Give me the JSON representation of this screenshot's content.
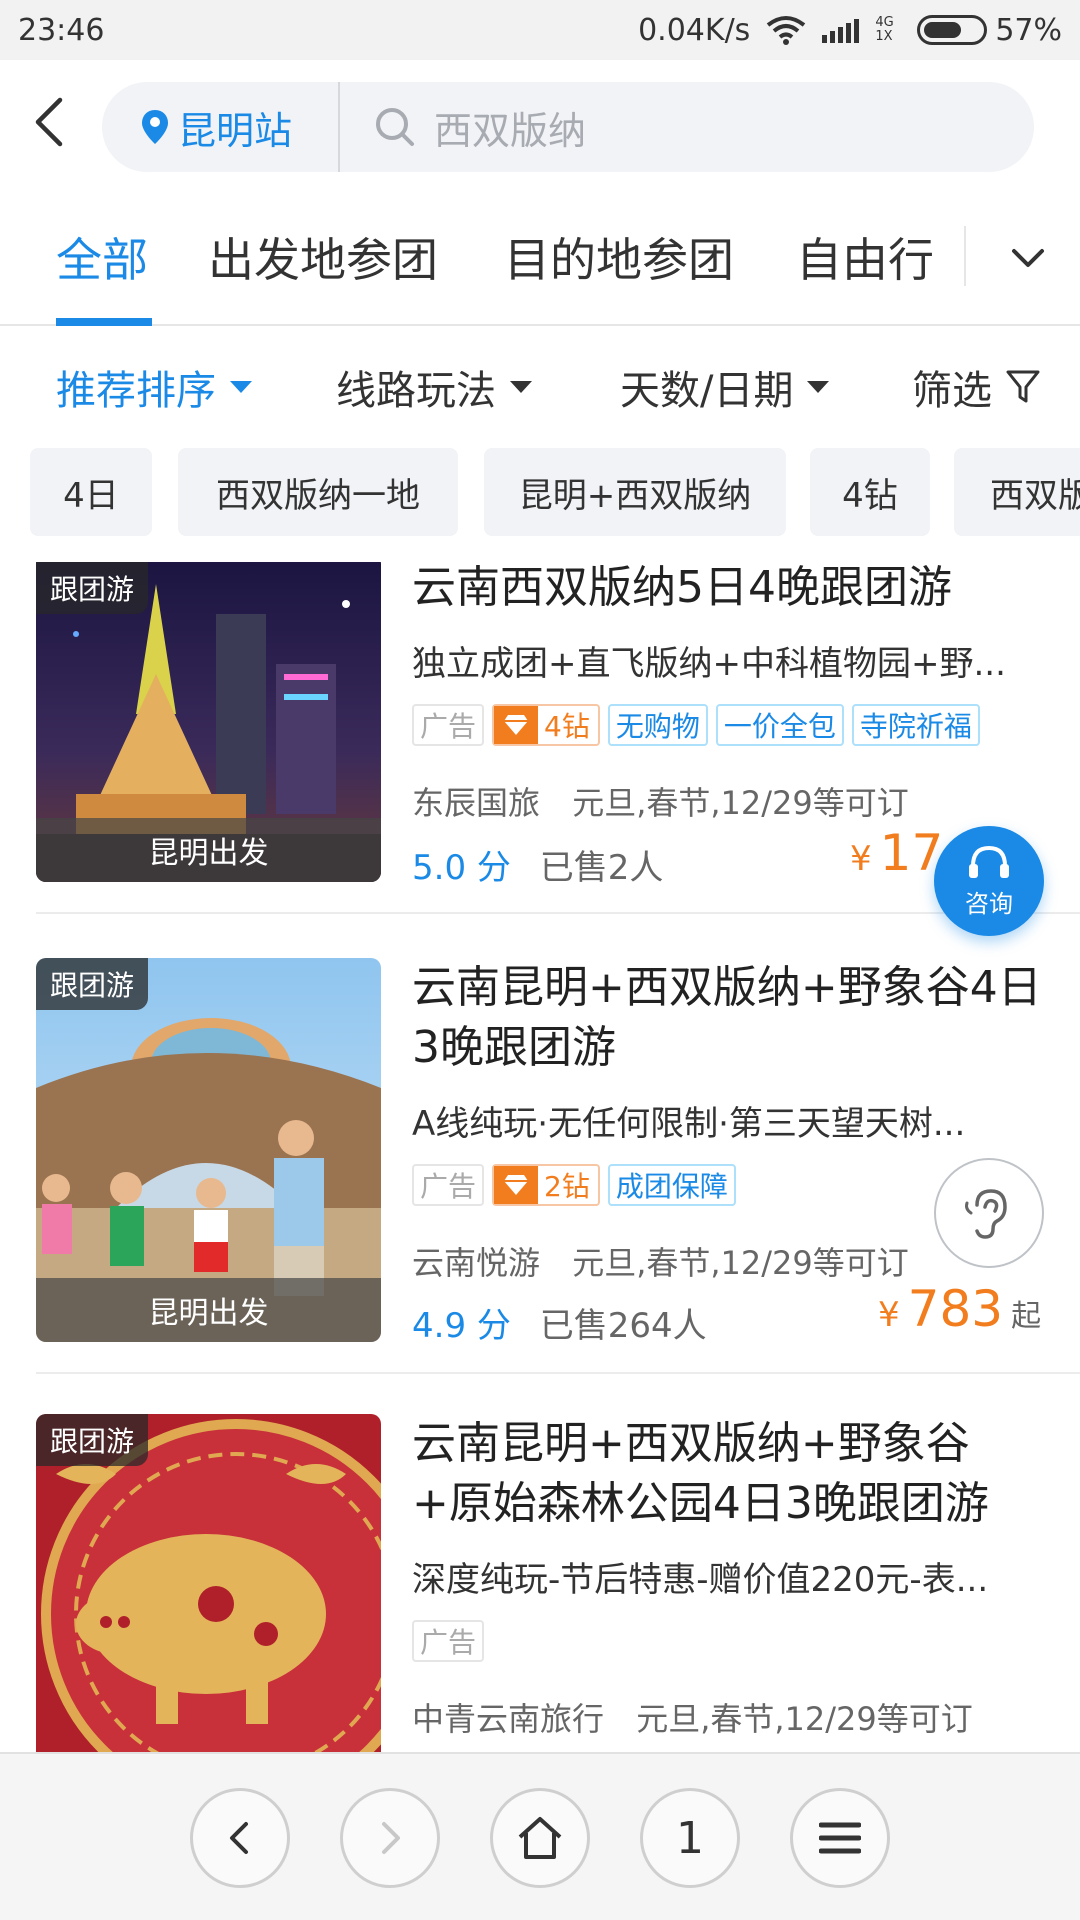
{
  "status_bar": {
    "time": "23:46",
    "net_speed": "0.04K/s",
    "network_label": "4G 1X",
    "battery": "57%"
  },
  "header": {
    "location": "昆明站",
    "search_placeholder": "西双版纳"
  },
  "tabs": [
    "全部",
    "出发地参团",
    "目的地参团",
    "自由行"
  ],
  "sort": {
    "recommend": "推荐排序",
    "route": "线路玩法",
    "days": "天数/日期",
    "filter": "筛选"
  },
  "chips": [
    "4日",
    "西双版纳一地",
    "昆明+西双版纳",
    "4钻",
    "西双版"
  ],
  "items": [
    {
      "tag": "跟团游",
      "depart": "昆明出发",
      "title": "云南西双版纳5日4晚跟团游",
      "desc": "独立成团+直飞版纳+中科植物园+野...",
      "ad": "广告",
      "diamond": "4钻",
      "labels": [
        "无购物",
        "一价全包",
        "寺院祈福"
      ],
      "agency": "东辰国旅",
      "dates": "元旦,春节,12/29等可订",
      "score": "5.0 分",
      "sold": "已售2人",
      "currency": "¥",
      "price": "17",
      "suffix": ""
    },
    {
      "tag": "跟团游",
      "depart": "昆明出发",
      "title": "云南昆明+西双版纳+野象谷4日3晚跟团游",
      "desc": "A线纯玩·无任何限制·第三天望天树...",
      "ad": "广告",
      "diamond": "2钻",
      "labels": [
        "成团保障"
      ],
      "agency": "云南悦游",
      "dates": "元旦,春节,12/29等可订",
      "score": "4.9 分",
      "sold": "已售264人",
      "currency": "¥",
      "price": "783",
      "suffix": "起"
    },
    {
      "tag": "跟团游",
      "title": "云南昆明+西双版纳+野象谷+原始森林公园4日3晚跟团游",
      "desc": "深度纯玩-节后特惠-赠价值220元-表...",
      "ad": "广告",
      "agency": "中青云南旅行",
      "dates": "元旦,春节,12/29等可订"
    }
  ],
  "floating": {
    "consult": "咨询",
    "listen_icon": "ear-icon"
  },
  "bottom_nav": {
    "page_count": "1"
  },
  "colors": {
    "accent": "#1a8ae6",
    "price": "#f27d1e"
  }
}
